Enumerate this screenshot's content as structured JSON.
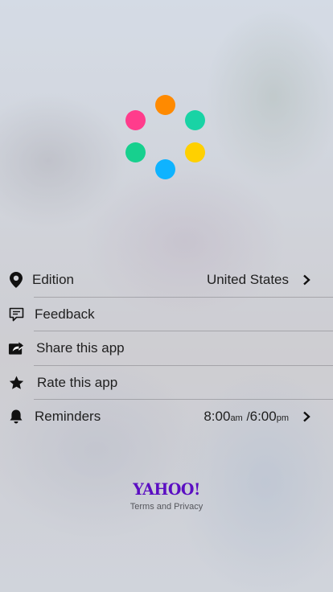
{
  "logo": {
    "dot_colors": [
      "#ff8a00",
      "#19d3a5",
      "#ffd000",
      "#0fb3ff",
      "#17d08e",
      "#ff3c8c"
    ]
  },
  "menu": {
    "items": [
      {
        "label": "Edition",
        "value": "United States",
        "icon": "location-pin-icon",
        "has_chevron": true
      },
      {
        "label": "Feedback",
        "icon": "feedback-icon"
      },
      {
        "label": "Share this app",
        "icon": "share-icon"
      },
      {
        "label": "Rate this app",
        "icon": "star-icon"
      },
      {
        "label": "Reminders",
        "icon": "bell-icon",
        "morning_time": "8:00",
        "morning_suffix": "am",
        "divider": "/",
        "evening_time": "6:00",
        "evening_suffix": "pm",
        "has_chevron": true
      }
    ]
  },
  "footer": {
    "brand": "YAHOO!",
    "terms": "Terms and Privacy",
    "brand_color": "#5b0ec2"
  }
}
